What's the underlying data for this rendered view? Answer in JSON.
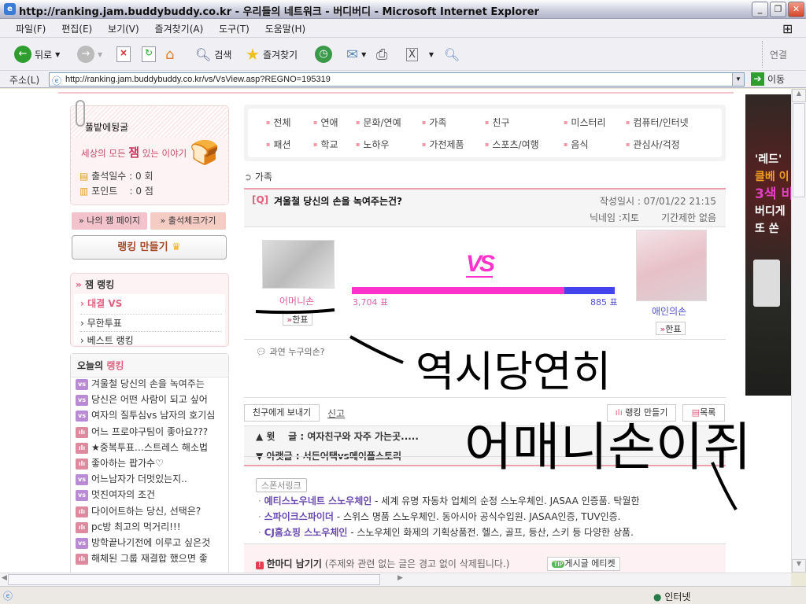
{
  "window": {
    "title": "http://ranking.jam.buddybuddy.co.kr - 우리들의 네트워크 - 버디버디 - Microsoft Internet Explorer"
  },
  "menu": [
    "파일(F)",
    "편집(E)",
    "보기(V)",
    "즐겨찾기(A)",
    "도구(T)",
    "도움말(H)"
  ],
  "toolbar": {
    "back": "뒤로",
    "search": "검색",
    "favorites": "즐겨찾기",
    "links": "연결"
  },
  "address": {
    "label": "주소(L)",
    "url": "http://ranking.jam.buddybuddy.co.kr/vs/VsView.asp?REGNO=195319",
    "go": "이동"
  },
  "sidebar": {
    "profile_title": "풀밭에뒹굴",
    "slogan_pre": "세상의 모든",
    "slogan_jam": "잼",
    "slogan_post": "있는 이야기",
    "attendance": "출석일수 : 0 회",
    "points": "포인트    : 0 점",
    "my_page": "나의 잼 페이지",
    "attendance_check": "출석체크가기",
    "make_ranking": "랭킹 만들기",
    "jam_ranking_title": "잼 랭킹",
    "jam_ranking_items": [
      "대결 VS",
      "무한투표",
      "베스트 랭킹"
    ],
    "today_title_pre": "오늘의",
    "today_title_accent": "랭킹",
    "today_items": [
      {
        "type": "vs",
        "text": "겨울철 당신의 손을 녹여주는"
      },
      {
        "type": "vs",
        "text": "당신은 어떤 사람이 되고 싶어"
      },
      {
        "type": "vs",
        "text": "여자의 질투심vs 남자의 호기심"
      },
      {
        "type": "bar",
        "text": "어느 프로야구팀이 좋아요???"
      },
      {
        "type": "bar",
        "text": "★중복투표…스트레스 해소법"
      },
      {
        "type": "bar",
        "text": "좋아하는 팝가수♡"
      },
      {
        "type": "vs",
        "text": "어느남자가 더멋있는지.."
      },
      {
        "type": "vs",
        "text": "멋진여자의 조건"
      },
      {
        "type": "bar",
        "text": "다이어트하는 당신, 선택은?"
      },
      {
        "type": "bar",
        "text": "pc방 최고의 먹거리!!!"
      },
      {
        "type": "vs",
        "text": "방학끝나기전에 이루고 싶은것"
      },
      {
        "type": "bar",
        "text": "해체된 그룹 재결합 했으면 좋"
      }
    ],
    "badge_vs": "vs",
    "badge_bar": "ılı"
  },
  "categories": [
    "전체",
    "연애",
    "문화/연예",
    "가족",
    "친구",
    "미스터리",
    "컴퓨터/인터넷",
    "패션",
    "학교",
    "노하우",
    "가전제품",
    "스포츠/여행",
    "음식",
    "관심사/걱정"
  ],
  "section": "가족",
  "question": {
    "tag": "[Q]",
    "title": "겨울철 당신의 손을 녹여주는건?",
    "date": "작성일시 : 07/01/22 21:15",
    "nickname": "닉네임 :지토",
    "period": "기간제한 없음"
  },
  "vs": {
    "label": "VS",
    "left": {
      "name": "어머니손",
      "votes_text": "3,704 표",
      "votes": 3704,
      "vote_btn": "한표"
    },
    "right": {
      "name": "애인의손",
      "votes_text": "885 표",
      "votes": 885,
      "vote_btn": "한표"
    },
    "colors": {
      "left": "#ff33cc",
      "right": "#4444ee"
    }
  },
  "hint": "과연 누구의손?",
  "actions": {
    "send": "친구에게 보내기",
    "report": "신고",
    "make": "랭킹 만들기",
    "list": "목록"
  },
  "nav": {
    "prev_label": "▲ 윗    글 :",
    "prev": "여자친구와 자주 가는곳.....",
    "next_label": "▼ 아랫글 :",
    "next": "서든어택vs메이플스토리"
  },
  "sponsor": {
    "label": "스폰서링크",
    "links": [
      {
        "title": "예티스노우네트 스노우체인",
        "desc": "- 세계 유명 자동차 업체의 순정 스노우체인. JASAA 인증품. 탁월한"
      },
      {
        "title": "스파이크스파이더",
        "desc": "- 스위스 명품 스노우체인. 동아시아 공식수입원. JASAA인증, TUV인증."
      },
      {
        "title": "CJ홈쇼핑 스노우체인",
        "desc": "- 스노우체인 화제의 기획상품전. 헬스, 골프, 등산, 스키 등 다양한 상품."
      }
    ]
  },
  "comment": {
    "title": "한마디 남기기",
    "note": "(주제와 관련 없는 글은 경고 없이 삭제됩니다.)",
    "tip": "TIP",
    "etiquette": "게시글 에티켓"
  },
  "ad": {
    "lines": [
      "'레드'",
      "클베 이",
      "3색 비",
      "버디게",
      "또 쏜"
    ]
  },
  "annotations": {
    "line1": "역시당연히",
    "line2": "어매니손이쥐"
  },
  "status": {
    "zone": "인터넷"
  }
}
